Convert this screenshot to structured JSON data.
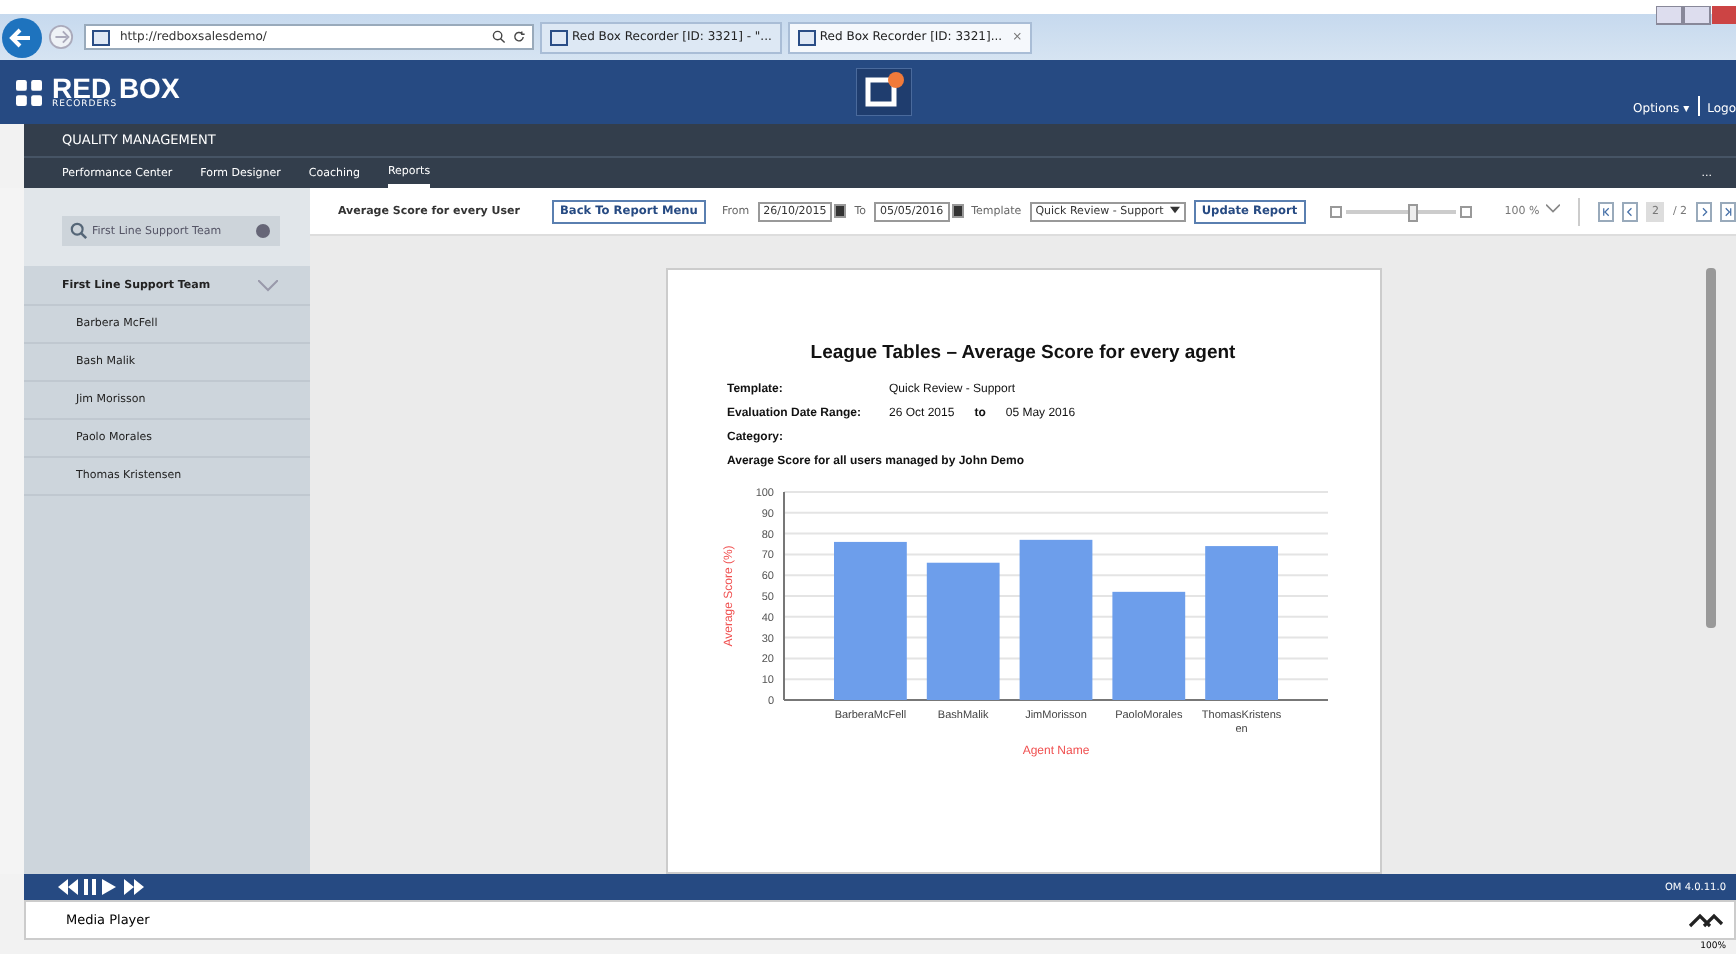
{
  "browser": {
    "url": "http://redboxsalesdemo/",
    "tabs": [
      {
        "label": "Red Box Recorder [ID: 3321] - \"...",
        "selected": false
      },
      {
        "label": "Red Box Recorder [ID: 3321]...",
        "selected": true
      }
    ],
    "close": "×"
  },
  "header": {
    "logo": "RED BOX",
    "logo_sub": "RECORDERS",
    "options": "Options ▾",
    "logout": "Logo"
  },
  "module": {
    "title": "QUALITY MANAGEMENT",
    "nav": [
      {
        "label": "Performance Center",
        "selected": false
      },
      {
        "label": "Form Designer",
        "selected": false
      },
      {
        "label": "Coaching",
        "selected": false
      },
      {
        "label": "Reports",
        "selected": true
      }
    ],
    "more": "..."
  },
  "sidebar": {
    "search": {
      "placeholder": "First Line Support Team"
    },
    "group": {
      "label": "First Line Support Team",
      "expanded": true,
      "children": [
        {
          "label": "Barbera McFell"
        },
        {
          "label": "Bash Malik"
        },
        {
          "label": "Jim Morisson"
        },
        {
          "label": "Paolo Morales"
        },
        {
          "label": "Thomas Kristensen"
        }
      ]
    }
  },
  "toolbar": {
    "title": "Average Score for every User",
    "back": "Back To Report Menu",
    "from_label": "From",
    "from": "26/10/2015",
    "to_label": "To",
    "to": "05/05/2016",
    "template_label": "Template",
    "template": "Quick Review - Support",
    "update": "Update Report",
    "level": 0.6,
    "zoom": "100 %",
    "page": "2",
    "pages": "/ 2"
  },
  "report": {
    "title": "League Tables – Average Score for every agent",
    "fields": [
      {
        "label": "Template:",
        "value": "Quick Review - Support"
      },
      {
        "label": "Evaluation Date Range:",
        "value": "26 Oct 2015",
        "joiner": "to",
        "value2": "05 May 2016"
      },
      {
        "label": "Category:"
      }
    ],
    "subtitle": "Average Score for all users managed by John Demo",
    "chart_data": {
      "type": "bar",
      "xlabel": "Agent Name",
      "ylabel": "Average Score (%)",
      "categories": [
        "BarberaMcFell",
        "BashMalik",
        "JimMorisson",
        "PaoloMorales",
        "ThomasKristensen"
      ],
      "series": [
        {
          "color": "#6d9eeb",
          "values": [
            76,
            66,
            77,
            52,
            74
          ]
        }
      ],
      "grid": true,
      "ylim": [
        0,
        100
      ],
      "yticks": [
        0,
        10,
        20,
        30,
        40,
        50,
        60,
        70,
        80,
        90,
        100
      ]
    }
  },
  "player": {
    "version": "OM 4.0.11.0"
  },
  "media_player": {
    "title": "Media Player"
  },
  "status": {
    "zoom": "100%"
  }
}
